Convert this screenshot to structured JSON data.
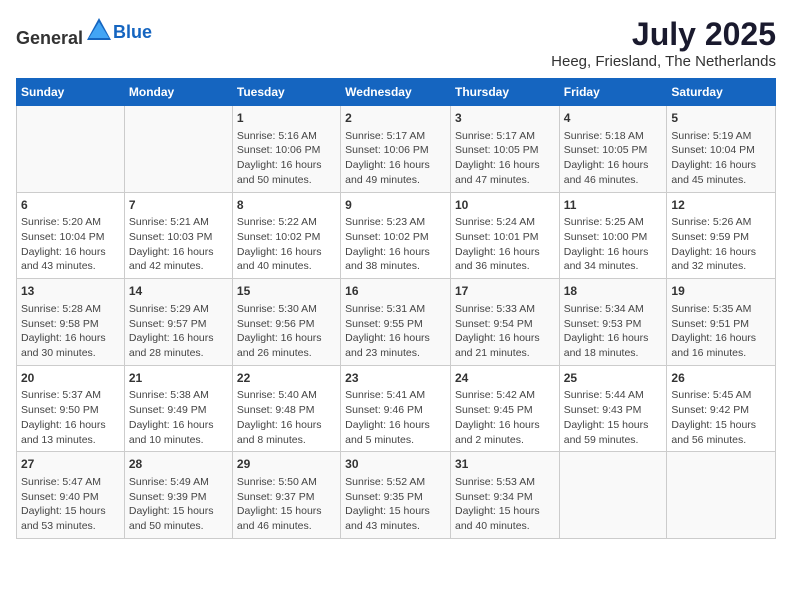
{
  "header": {
    "logo_general": "General",
    "logo_blue": "Blue",
    "title": "July 2025",
    "subtitle": "Heeg, Friesland, The Netherlands"
  },
  "weekdays": [
    "Sunday",
    "Monday",
    "Tuesday",
    "Wednesday",
    "Thursday",
    "Friday",
    "Saturday"
  ],
  "weeks": [
    [
      {
        "day": "",
        "content": ""
      },
      {
        "day": "",
        "content": ""
      },
      {
        "day": "1",
        "content": "Sunrise: 5:16 AM\nSunset: 10:06 PM\nDaylight: 16 hours and 50 minutes."
      },
      {
        "day": "2",
        "content": "Sunrise: 5:17 AM\nSunset: 10:06 PM\nDaylight: 16 hours and 49 minutes."
      },
      {
        "day": "3",
        "content": "Sunrise: 5:17 AM\nSunset: 10:05 PM\nDaylight: 16 hours and 47 minutes."
      },
      {
        "day": "4",
        "content": "Sunrise: 5:18 AM\nSunset: 10:05 PM\nDaylight: 16 hours and 46 minutes."
      },
      {
        "day": "5",
        "content": "Sunrise: 5:19 AM\nSunset: 10:04 PM\nDaylight: 16 hours and 45 minutes."
      }
    ],
    [
      {
        "day": "6",
        "content": "Sunrise: 5:20 AM\nSunset: 10:04 PM\nDaylight: 16 hours and 43 minutes."
      },
      {
        "day": "7",
        "content": "Sunrise: 5:21 AM\nSunset: 10:03 PM\nDaylight: 16 hours and 42 minutes."
      },
      {
        "day": "8",
        "content": "Sunrise: 5:22 AM\nSunset: 10:02 PM\nDaylight: 16 hours and 40 minutes."
      },
      {
        "day": "9",
        "content": "Sunrise: 5:23 AM\nSunset: 10:02 PM\nDaylight: 16 hours and 38 minutes."
      },
      {
        "day": "10",
        "content": "Sunrise: 5:24 AM\nSunset: 10:01 PM\nDaylight: 16 hours and 36 minutes."
      },
      {
        "day": "11",
        "content": "Sunrise: 5:25 AM\nSunset: 10:00 PM\nDaylight: 16 hours and 34 minutes."
      },
      {
        "day": "12",
        "content": "Sunrise: 5:26 AM\nSunset: 9:59 PM\nDaylight: 16 hours and 32 minutes."
      }
    ],
    [
      {
        "day": "13",
        "content": "Sunrise: 5:28 AM\nSunset: 9:58 PM\nDaylight: 16 hours and 30 minutes."
      },
      {
        "day": "14",
        "content": "Sunrise: 5:29 AM\nSunset: 9:57 PM\nDaylight: 16 hours and 28 minutes."
      },
      {
        "day": "15",
        "content": "Sunrise: 5:30 AM\nSunset: 9:56 PM\nDaylight: 16 hours and 26 minutes."
      },
      {
        "day": "16",
        "content": "Sunrise: 5:31 AM\nSunset: 9:55 PM\nDaylight: 16 hours and 23 minutes."
      },
      {
        "day": "17",
        "content": "Sunrise: 5:33 AM\nSunset: 9:54 PM\nDaylight: 16 hours and 21 minutes."
      },
      {
        "day": "18",
        "content": "Sunrise: 5:34 AM\nSunset: 9:53 PM\nDaylight: 16 hours and 18 minutes."
      },
      {
        "day": "19",
        "content": "Sunrise: 5:35 AM\nSunset: 9:51 PM\nDaylight: 16 hours and 16 minutes."
      }
    ],
    [
      {
        "day": "20",
        "content": "Sunrise: 5:37 AM\nSunset: 9:50 PM\nDaylight: 16 hours and 13 minutes."
      },
      {
        "day": "21",
        "content": "Sunrise: 5:38 AM\nSunset: 9:49 PM\nDaylight: 16 hours and 10 minutes."
      },
      {
        "day": "22",
        "content": "Sunrise: 5:40 AM\nSunset: 9:48 PM\nDaylight: 16 hours and 8 minutes."
      },
      {
        "day": "23",
        "content": "Sunrise: 5:41 AM\nSunset: 9:46 PM\nDaylight: 16 hours and 5 minutes."
      },
      {
        "day": "24",
        "content": "Sunrise: 5:42 AM\nSunset: 9:45 PM\nDaylight: 16 hours and 2 minutes."
      },
      {
        "day": "25",
        "content": "Sunrise: 5:44 AM\nSunset: 9:43 PM\nDaylight: 15 hours and 59 minutes."
      },
      {
        "day": "26",
        "content": "Sunrise: 5:45 AM\nSunset: 9:42 PM\nDaylight: 15 hours and 56 minutes."
      }
    ],
    [
      {
        "day": "27",
        "content": "Sunrise: 5:47 AM\nSunset: 9:40 PM\nDaylight: 15 hours and 53 minutes."
      },
      {
        "day": "28",
        "content": "Sunrise: 5:49 AM\nSunset: 9:39 PM\nDaylight: 15 hours and 50 minutes."
      },
      {
        "day": "29",
        "content": "Sunrise: 5:50 AM\nSunset: 9:37 PM\nDaylight: 15 hours and 46 minutes."
      },
      {
        "day": "30",
        "content": "Sunrise: 5:52 AM\nSunset: 9:35 PM\nDaylight: 15 hours and 43 minutes."
      },
      {
        "day": "31",
        "content": "Sunrise: 5:53 AM\nSunset: 9:34 PM\nDaylight: 15 hours and 40 minutes."
      },
      {
        "day": "",
        "content": ""
      },
      {
        "day": "",
        "content": ""
      }
    ]
  ]
}
